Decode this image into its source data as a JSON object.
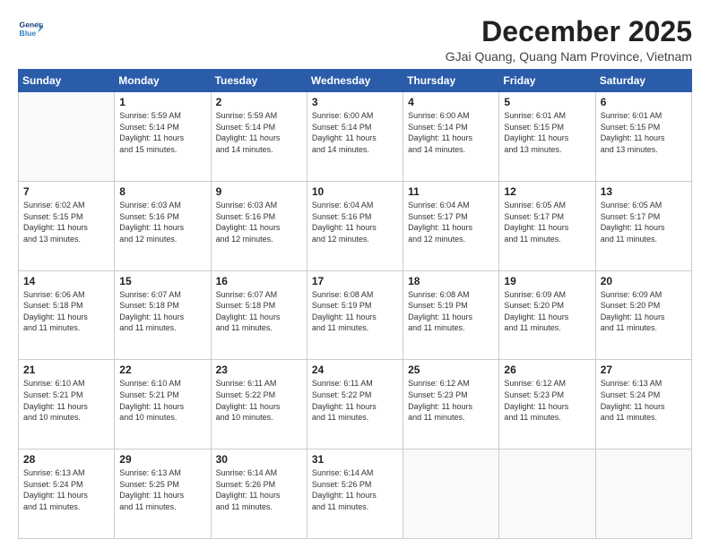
{
  "header": {
    "logo_line1": "General",
    "logo_line2": "Blue",
    "month_title": "December 2025",
    "subtitle": "GJai Quang, Quang Nam Province, Vietnam"
  },
  "weekdays": [
    "Sunday",
    "Monday",
    "Tuesday",
    "Wednesday",
    "Thursday",
    "Friday",
    "Saturday"
  ],
  "weeks": [
    [
      {
        "day": "",
        "info": ""
      },
      {
        "day": "1",
        "info": "Sunrise: 5:59 AM\nSunset: 5:14 PM\nDaylight: 11 hours\nand 15 minutes."
      },
      {
        "day": "2",
        "info": "Sunrise: 5:59 AM\nSunset: 5:14 PM\nDaylight: 11 hours\nand 14 minutes."
      },
      {
        "day": "3",
        "info": "Sunrise: 6:00 AM\nSunset: 5:14 PM\nDaylight: 11 hours\nand 14 minutes."
      },
      {
        "day": "4",
        "info": "Sunrise: 6:00 AM\nSunset: 5:14 PM\nDaylight: 11 hours\nand 14 minutes."
      },
      {
        "day": "5",
        "info": "Sunrise: 6:01 AM\nSunset: 5:15 PM\nDaylight: 11 hours\nand 13 minutes."
      },
      {
        "day": "6",
        "info": "Sunrise: 6:01 AM\nSunset: 5:15 PM\nDaylight: 11 hours\nand 13 minutes."
      }
    ],
    [
      {
        "day": "7",
        "info": "Sunrise: 6:02 AM\nSunset: 5:15 PM\nDaylight: 11 hours\nand 13 minutes."
      },
      {
        "day": "8",
        "info": "Sunrise: 6:03 AM\nSunset: 5:16 PM\nDaylight: 11 hours\nand 12 minutes."
      },
      {
        "day": "9",
        "info": "Sunrise: 6:03 AM\nSunset: 5:16 PM\nDaylight: 11 hours\nand 12 minutes."
      },
      {
        "day": "10",
        "info": "Sunrise: 6:04 AM\nSunset: 5:16 PM\nDaylight: 11 hours\nand 12 minutes."
      },
      {
        "day": "11",
        "info": "Sunrise: 6:04 AM\nSunset: 5:17 PM\nDaylight: 11 hours\nand 12 minutes."
      },
      {
        "day": "12",
        "info": "Sunrise: 6:05 AM\nSunset: 5:17 PM\nDaylight: 11 hours\nand 11 minutes."
      },
      {
        "day": "13",
        "info": "Sunrise: 6:05 AM\nSunset: 5:17 PM\nDaylight: 11 hours\nand 11 minutes."
      }
    ],
    [
      {
        "day": "14",
        "info": "Sunrise: 6:06 AM\nSunset: 5:18 PM\nDaylight: 11 hours\nand 11 minutes."
      },
      {
        "day": "15",
        "info": "Sunrise: 6:07 AM\nSunset: 5:18 PM\nDaylight: 11 hours\nand 11 minutes."
      },
      {
        "day": "16",
        "info": "Sunrise: 6:07 AM\nSunset: 5:18 PM\nDaylight: 11 hours\nand 11 minutes."
      },
      {
        "day": "17",
        "info": "Sunrise: 6:08 AM\nSunset: 5:19 PM\nDaylight: 11 hours\nand 11 minutes."
      },
      {
        "day": "18",
        "info": "Sunrise: 6:08 AM\nSunset: 5:19 PM\nDaylight: 11 hours\nand 11 minutes."
      },
      {
        "day": "19",
        "info": "Sunrise: 6:09 AM\nSunset: 5:20 PM\nDaylight: 11 hours\nand 11 minutes."
      },
      {
        "day": "20",
        "info": "Sunrise: 6:09 AM\nSunset: 5:20 PM\nDaylight: 11 hours\nand 11 minutes."
      }
    ],
    [
      {
        "day": "21",
        "info": "Sunrise: 6:10 AM\nSunset: 5:21 PM\nDaylight: 11 hours\nand 10 minutes."
      },
      {
        "day": "22",
        "info": "Sunrise: 6:10 AM\nSunset: 5:21 PM\nDaylight: 11 hours\nand 10 minutes."
      },
      {
        "day": "23",
        "info": "Sunrise: 6:11 AM\nSunset: 5:22 PM\nDaylight: 11 hours\nand 10 minutes."
      },
      {
        "day": "24",
        "info": "Sunrise: 6:11 AM\nSunset: 5:22 PM\nDaylight: 11 hours\nand 11 minutes."
      },
      {
        "day": "25",
        "info": "Sunrise: 6:12 AM\nSunset: 5:23 PM\nDaylight: 11 hours\nand 11 minutes."
      },
      {
        "day": "26",
        "info": "Sunrise: 6:12 AM\nSunset: 5:23 PM\nDaylight: 11 hours\nand 11 minutes."
      },
      {
        "day": "27",
        "info": "Sunrise: 6:13 AM\nSunset: 5:24 PM\nDaylight: 11 hours\nand 11 minutes."
      }
    ],
    [
      {
        "day": "28",
        "info": "Sunrise: 6:13 AM\nSunset: 5:24 PM\nDaylight: 11 hours\nand 11 minutes."
      },
      {
        "day": "29",
        "info": "Sunrise: 6:13 AM\nSunset: 5:25 PM\nDaylight: 11 hours\nand 11 minutes."
      },
      {
        "day": "30",
        "info": "Sunrise: 6:14 AM\nSunset: 5:26 PM\nDaylight: 11 hours\nand 11 minutes."
      },
      {
        "day": "31",
        "info": "Sunrise: 6:14 AM\nSunset: 5:26 PM\nDaylight: 11 hours\nand 11 minutes."
      },
      {
        "day": "",
        "info": ""
      },
      {
        "day": "",
        "info": ""
      },
      {
        "day": "",
        "info": ""
      }
    ]
  ]
}
